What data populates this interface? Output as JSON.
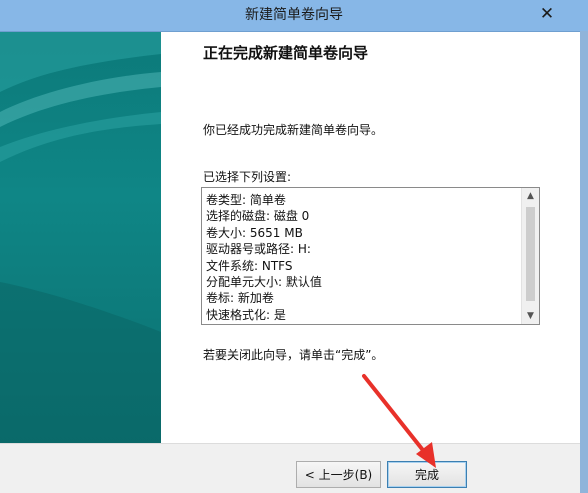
{
  "window": {
    "title": "新建简单卷向导",
    "close_label": "✕"
  },
  "page": {
    "heading": "正在完成新建简单卷向导",
    "success_message": "你已经成功完成新建简单卷向导。",
    "settings_label": "已选择下列设置:",
    "settings": [
      "卷类型: 简单卷",
      "选择的磁盘: 磁盘 0",
      "卷大小: 5651 MB",
      "驱动器号或路径: H:",
      "文件系统: NTFS",
      "分配单元大小: 默认值",
      "卷标: 新加卷",
      "快速格式化: 是"
    ],
    "close_hint": "若要关闭此向导，请单击“完成”。"
  },
  "buttons": {
    "back": "< 上一步(B)",
    "finish": "完成"
  },
  "scrollbar": {
    "up_glyph": "▲",
    "down_glyph": "▼"
  },
  "colors": {
    "banner": "#0f8686",
    "titlebar": "#87b7e7",
    "arrow": "#e8312a"
  }
}
